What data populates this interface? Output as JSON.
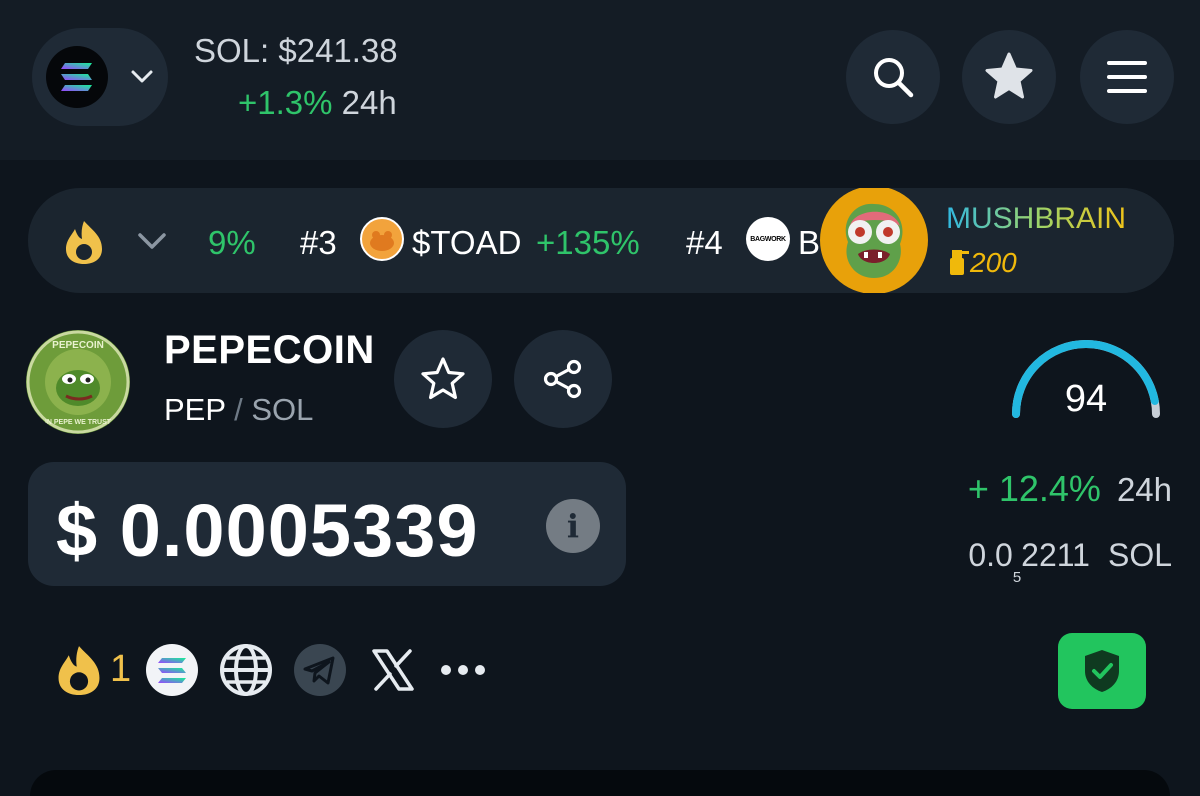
{
  "header": {
    "chain_icon": "solana-logo",
    "sol_price": "SOL: $241.38",
    "sol_change": "+1.3%",
    "sol_period": "24h",
    "search_icon": "search-icon",
    "favorites_icon": "star-icon",
    "menu_icon": "hamburger-menu-icon"
  },
  "ticker": {
    "fire_icon": "flame-icon",
    "partial_pct": "9%",
    "items": [
      {
        "rank": "#3",
        "symbol": "$TOAD",
        "change": "+135%"
      },
      {
        "rank": "#4",
        "symbol": "B",
        "logo_text": "BAGWORK"
      }
    ],
    "featured": {
      "name": "MUSHBRAIN",
      "score": "200",
      "score_icon": "spray-bottle-icon"
    }
  },
  "token": {
    "logo_text": "PEPECOIN",
    "logo_motto": "IN PEPE WE TRUST",
    "name": "PEPECOIN",
    "symbol": "PEP",
    "separator": "/",
    "base": "SOL",
    "price": "$ 0.0005339",
    "info_glyph": "i",
    "score": "94",
    "score_fraction": 0.94,
    "change_24h": "+ 12.4%",
    "change_period": "24h",
    "sol_price_lead": "0.0",
    "sol_price_zeros": "5",
    "sol_price_digits": "2211",
    "sol_unit": "SOL"
  },
  "links": {
    "hot_count": "1",
    "icons": [
      "flame-icon",
      "solana-icon",
      "globe-icon",
      "telegram-icon",
      "x-icon",
      "more-icon"
    ]
  },
  "colors": {
    "background": "#0e151d",
    "positive": "#2fc46a",
    "gauge": "#22b8e0",
    "shield": "#22c55e",
    "gold": "#f0b90b"
  }
}
